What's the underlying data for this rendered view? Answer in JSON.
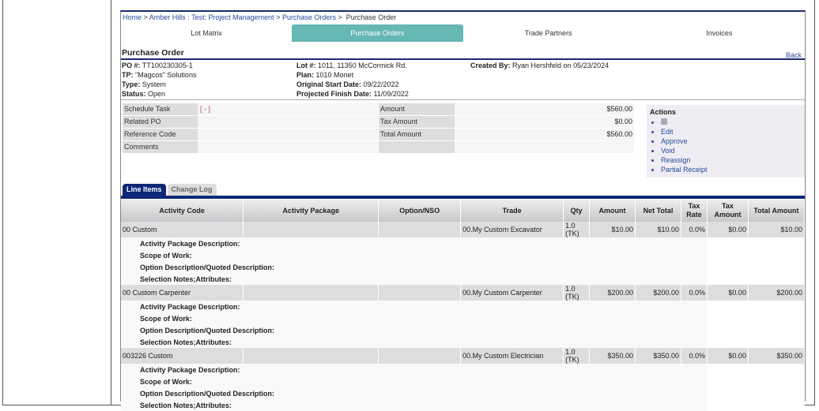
{
  "breadcrumb": [
    "Home",
    "Amber Hills : Test: Project Management",
    "Purchase Orders",
    "Purchase Order"
  ],
  "tabs": [
    "Lot Matrix",
    "Purchase Orders",
    "Trade Partners",
    "Invoices"
  ],
  "title": "Purchase Order",
  "back": "Back",
  "info": {
    "po_label": "PO #:",
    "po": "TT100230305-1",
    "tp_label": "TP:",
    "tp": "\"Magcos\" Solutions",
    "type_label": "Type:",
    "type": "System",
    "status_label": "Status:",
    "status": "Open",
    "lot_label": "Lot #:",
    "lot": "1011, 11350 McCormick Rd.",
    "plan_label": "Plan:",
    "plan": "1010 Monet",
    "start_label": "Original Start Date:",
    "start": "09/22/2022",
    "finish_label": "Projected Finish Date:",
    "finish": "11/09/2022",
    "created_label": "Created By:",
    "created": "Ryan Hershfeld on 05/23/2024"
  },
  "fields": {
    "schedule_task": "Schedule Task",
    "schedule_value": "[ - ]",
    "related_po": "Related PO",
    "reference_code": "Reference Code",
    "comments": "Comments",
    "amount": "Amount",
    "amount_value": "$560.00",
    "tax_amount": "Tax Amount",
    "tax_value": "$0.00",
    "total_amount": "Total Amount",
    "total_value": "$560.00"
  },
  "actions": {
    "title": "Actions",
    "items": [
      "Edit",
      "Approve",
      "Void",
      "Reassign",
      "Partial Receipt"
    ]
  },
  "line_tabs": [
    "Line Items",
    "Change Log"
  ],
  "columns": [
    "Activity Code",
    "Activity Package",
    "Option/NSO",
    "Trade",
    "Qty",
    "Amount",
    "Net Total",
    "Tax Rate",
    "Tax Amount",
    "Total Amount"
  ],
  "detail_labels": [
    "Activity Package Description:",
    "Scope of Work:",
    "Option Description/Quoted Description:",
    "Selection Notes;Attributes:"
  ],
  "rows": [
    {
      "code": "00 Custom",
      "package": "",
      "option": "",
      "trade": "00.My Custom Excavator",
      "qty": "1.0 (TK)",
      "amount": "$10.00",
      "net": "$10.00",
      "rate": "0.0%",
      "tax": "$0.00",
      "total": "$10.00"
    },
    {
      "code": "00 Custom Carpenter",
      "package": "",
      "option": "",
      "trade": "00.My Custom Carpenter",
      "qty": "1.0 (TK)",
      "amount": "$200.00",
      "net": "$200.00",
      "rate": "0.0%",
      "tax": "$0.00",
      "total": "$200.00"
    },
    {
      "code": "003226 Custom",
      "package": "",
      "option": "",
      "trade": "00.My Custom Electrician",
      "qty": "1.0 (TK)",
      "amount": "$350.00",
      "net": "$350.00",
      "rate": "0.0%",
      "tax": "$0.00",
      "total": "$350.00"
    }
  ]
}
